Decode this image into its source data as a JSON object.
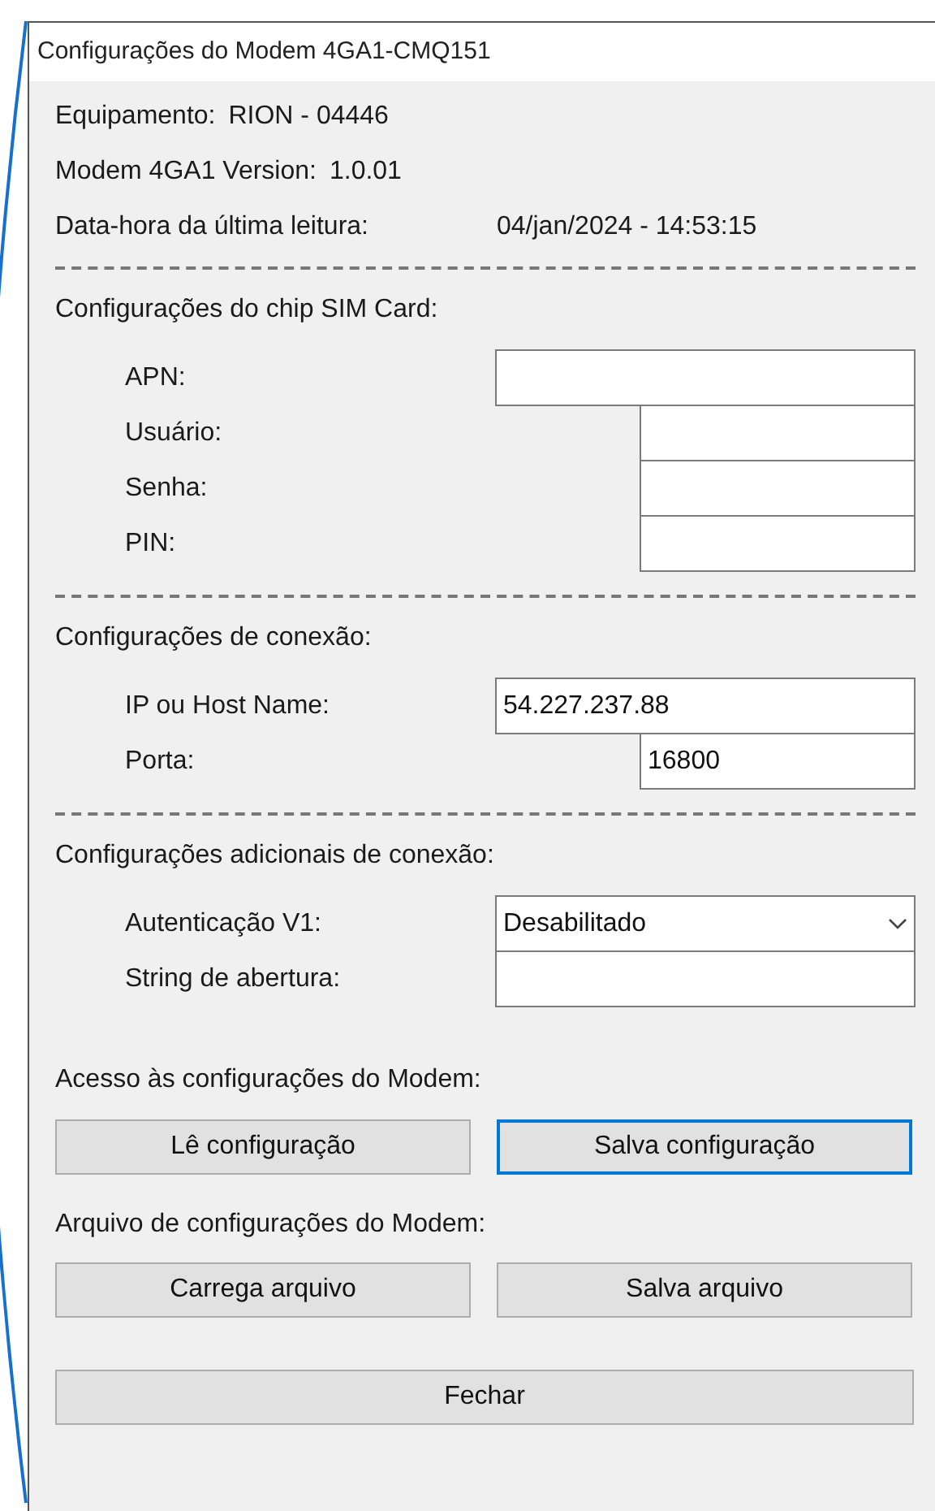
{
  "window": {
    "title": "Configurações do Modem 4GA1-CMQ151"
  },
  "info": [
    {
      "label": "Equipamento:",
      "value": "RION - 04446"
    },
    {
      "label": "Modem 4GA1 Version:",
      "value": "1.0.01"
    },
    {
      "label": "Data-hora da última leitura:",
      "value": "04/jan/2024 - 14:53:15"
    }
  ],
  "sections": [
    {
      "heading": "Configurações do chip SIM Card:",
      "fields": [
        {
          "label": "APN:",
          "kind": "text"
        },
        {
          "label": "Usuário:",
          "kind": "short_text"
        },
        {
          "label": "Senha:",
          "kind": "short_text"
        },
        {
          "label": "PIN:",
          "kind": "short_text"
        }
      ]
    },
    {
      "heading": "Configurações de conexão:",
      "fields": [
        {
          "label": "IP ou Host Name:",
          "kind": "text",
          "value": "54.227.237.88"
        },
        {
          "label": "Porta:",
          "kind": "short_text",
          "value": "16800"
        }
      ]
    },
    {
      "heading": "Configurações adicionais de conexão:",
      "fields": [
        {
          "label": "Autenticação V1:",
          "kind": "select",
          "value": "Desabilitado"
        },
        {
          "label": "String de abertura:",
          "kind": "text"
        }
      ]
    }
  ],
  "button_groups": [
    {
      "heading": "Acesso às configurações do Modem:",
      "buttons": [
        {
          "label": "Lê configuração",
          "focused": false
        },
        {
          "label": "Salva configuração",
          "focused": true
        }
      ]
    },
    {
      "heading": "Arquivo de configurações do Modem:",
      "buttons": [
        {
          "label": "Carrega arquivo",
          "focused": false
        },
        {
          "label": "Salva arquivo",
          "focused": false
        }
      ]
    }
  ],
  "close_button": {
    "label": "Fechar"
  }
}
